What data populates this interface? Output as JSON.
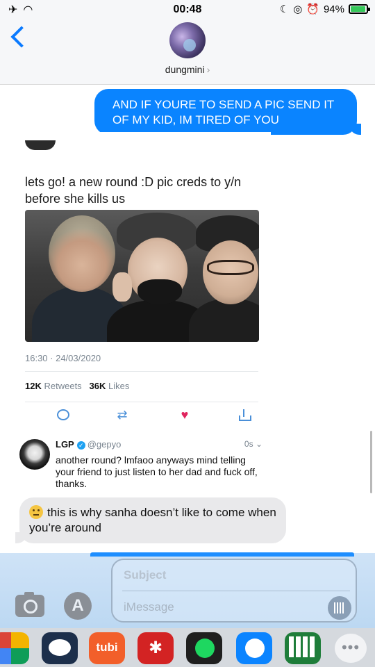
{
  "status_bar": {
    "time": "00:48",
    "battery_percent": "94%",
    "airplane_icon": "airplane-icon",
    "wifi_icon": "wifi-icon"
  },
  "header": {
    "contact_name": "dungmini",
    "chevron": "›"
  },
  "messages": {
    "sent_1": "AND IF YOURE TO SEND A PIC SEND IT OF MY KID, IM TIRED OF YOU",
    "received_1": "this is why sanha doesn’t like to come when you’re around"
  },
  "tweet": {
    "text": "lets go! a new round :D pic creds to y/n before she kills us",
    "timestamp": "16:30 · 24/03/2020",
    "retweets_count": "12K",
    "retweets_label": "Retweets",
    "likes_count": "36K",
    "likes_label": "Likes"
  },
  "reply": {
    "name": "LGP",
    "handle": "@gepyo",
    "time": "0s",
    "text": "another round? lmfaoo anyways mind telling your friend to just listen to her dad and fuck off, thanks."
  },
  "composer": {
    "subject_placeholder": "Subject",
    "message_placeholder": "iMessage"
  },
  "app_drawer": {
    "tubi_label": "tubi",
    "yelp_label": "✱",
    "more_label": "•••"
  },
  "colors": {
    "imessage_blue": "#0a84ff",
    "received_gray": "#e9e9eb",
    "like_red": "#e0245e",
    "twitter_blue": "#1da1f2"
  }
}
